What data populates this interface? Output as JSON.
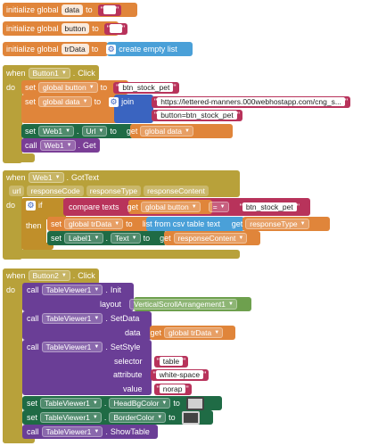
{
  "block1": {
    "init": "initialize global",
    "var": "data",
    "to": "to",
    "q": "\"",
    "value": ""
  },
  "block2": {
    "init": "initialize global",
    "var": "button",
    "to": "to",
    "q": "\"",
    "value": ""
  },
  "block3": {
    "init": "initialize global",
    "var": "trData",
    "to": "to",
    "value": "create empty list"
  },
  "event1": {
    "when": "when",
    "component": "Button1",
    "dot": ".",
    "event": "Click",
    "do": "do",
    "set1": {
      "set": "set",
      "var": "global button",
      "to": "to",
      "q": "\"",
      "value": "btn_stock_pet"
    },
    "set2": {
      "set": "set",
      "var": "global data",
      "to": "to",
      "join": "join",
      "v1": "https://lettered-manners.000webhostapp.com/cng_s...",
      "v2": "button=btn_stock_pet"
    },
    "set3": {
      "set": "set",
      "component": "Web1",
      "dot": ".",
      "prop": "Url",
      "to": "to",
      "get": "get",
      "var": "global data"
    },
    "call": {
      "call": "call",
      "component": "Web1",
      "dot": ".",
      "method": "Get"
    }
  },
  "event2": {
    "when": "when",
    "component": "Web1",
    "dot": ".",
    "event": "GotText",
    "params": [
      "url",
      "responseCode",
      "responseType",
      "responseContent"
    ],
    "do": "do",
    "if": "if",
    "then": "then",
    "compare": {
      "label": "compare texts",
      "get": "get",
      "var": "global button",
      "op": "=",
      "q": "\"",
      "value": "btn_stock_pet"
    },
    "set1": {
      "set": "set",
      "var": "global trData",
      "to": "to",
      "func": "list from csv table",
      "text": "text",
      "get": "get",
      "arg": "responseType"
    },
    "set2": {
      "set": "set",
      "component": "Label1",
      "dot": ".",
      "prop": "Text",
      "to": "to",
      "get": "get",
      "arg": "responseContent"
    }
  },
  "event3": {
    "when": "when",
    "component": "Button2",
    "dot": ".",
    "event": "Click",
    "do": "do",
    "init": {
      "call": "call",
      "component": "TableViewer1",
      "dot": ".",
      "method": "Init",
      "layout_label": "layout",
      "layout_value": "VerticalScrollArrangement1"
    },
    "setdata": {
      "call": "call",
      "component": "TableViewer1",
      "dot": ".",
      "method": "SetData",
      "data_label": "data",
      "get": "get",
      "var": "global trData"
    },
    "setstyle": {
      "call": "call",
      "component": "TableViewer1",
      "dot": ".",
      "method": "SetStyle",
      "selector_label": "selector",
      "selector_value": "table",
      "attribute_label": "attribute",
      "attribute_value": "white-space",
      "value_label": "value",
      "value_value": "norap",
      "q": "\""
    },
    "headbg": {
      "set": "set",
      "component": "TableViewer1",
      "dot": ".",
      "prop": "HeadBgColor",
      "to": "to",
      "color": "#d0d0d0"
    },
    "border": {
      "set": "set",
      "component": "TableViewer1",
      "dot": ".",
      "prop": "BorderColor",
      "to": "to",
      "color": "#444444"
    },
    "show": {
      "call": "call",
      "component": "TableViewer1",
      "dot": ".",
      "method": "ShowTable"
    }
  }
}
